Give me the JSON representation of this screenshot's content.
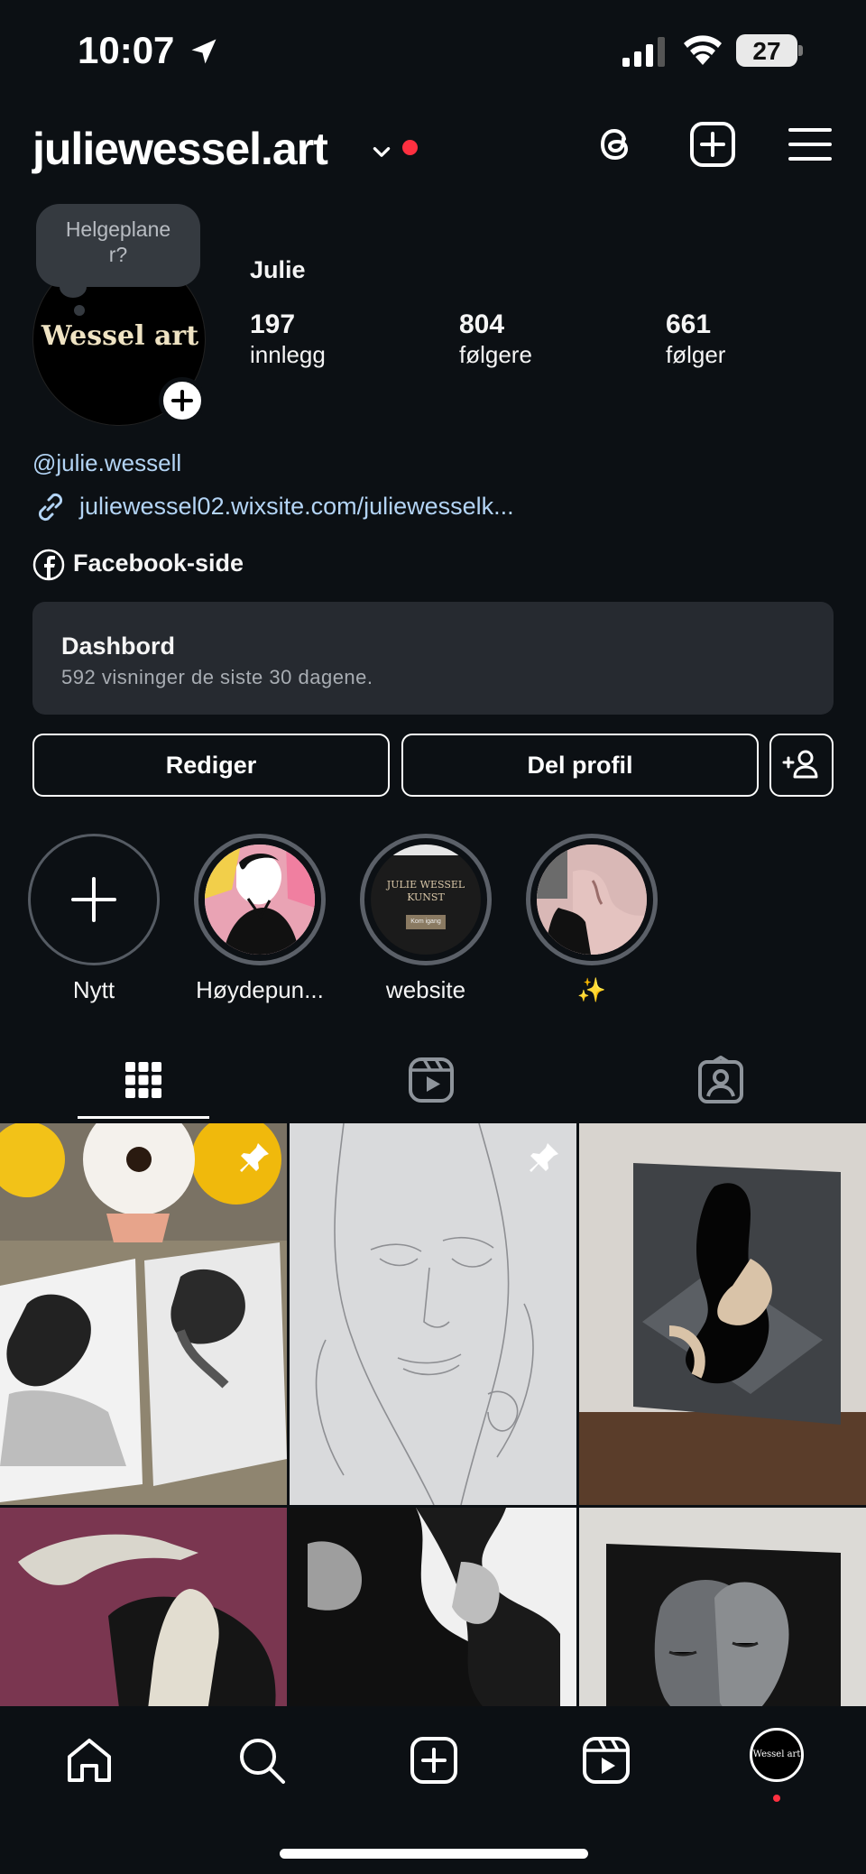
{
  "status_bar": {
    "time": "10:07",
    "battery": "27"
  },
  "header": {
    "username": "juliewessel.art"
  },
  "note": {
    "text": "Helgeplaner?"
  },
  "avatar": {
    "text": "Wessel art"
  },
  "profile": {
    "name": "Julie",
    "stats": [
      {
        "num": "197",
        "label": "innlegg"
      },
      {
        "num": "804",
        "label": "følgere"
      },
      {
        "num": "661",
        "label": "følger"
      }
    ],
    "handle": "@julie.wessell",
    "link": "juliewessel02.wixsite.com/juliewesselk...",
    "facebook": "Facebook-side"
  },
  "dashboard": {
    "title": "Dashbord",
    "subtitle": "592 visninger de siste 30 dagene."
  },
  "buttons": {
    "edit": "Rediger",
    "share": "Del profil"
  },
  "highlights": [
    {
      "label": "Nytt"
    },
    {
      "label": "Høydepun..."
    },
    {
      "label": "website",
      "mini_title": "JULIE WESSEL KUNST",
      "mini_btn": "Kom igang"
    },
    {
      "label": "✨"
    }
  ],
  "nav_avatar": "Wessel art",
  "colors": {
    "background": "#0c1014",
    "link": "#b3d4f5",
    "notification": "#ff3040",
    "card": "#262a30"
  }
}
